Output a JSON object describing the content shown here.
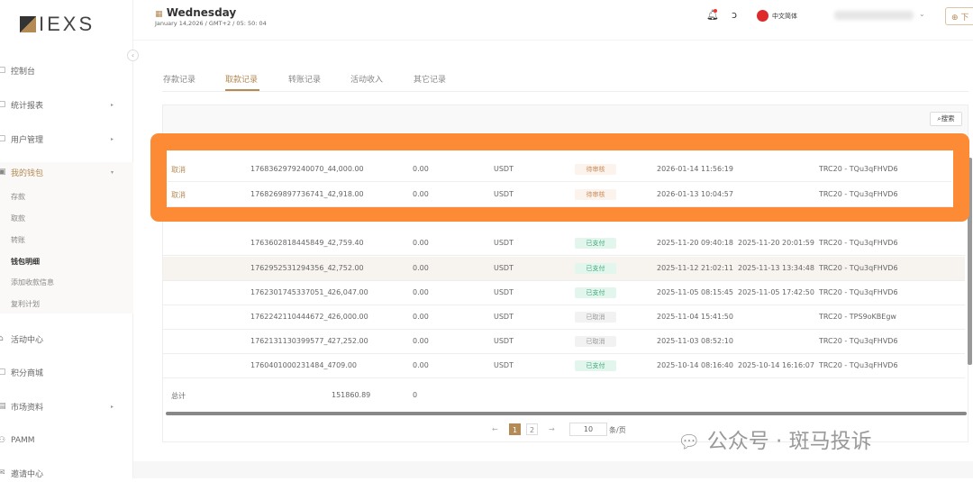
{
  "logo": "IEXS",
  "header": {
    "day": "Wednesday",
    "datetime": "January 14,2026 / GMT+2 / 05: 50: 04",
    "language": "中文简体",
    "download": "下"
  },
  "sidebar": {
    "items": [
      {
        "label": "控制台"
      },
      {
        "label": "统计报表"
      },
      {
        "label": "用户管理"
      },
      {
        "label": "我的钱包"
      },
      {
        "label": "活动中心"
      },
      {
        "label": "积分商城"
      },
      {
        "label": "市场资料"
      },
      {
        "label": "PAMM"
      },
      {
        "label": "邀请中心"
      }
    ],
    "wallet_sub": [
      "存款",
      "取款",
      "转账",
      "钱包明细",
      "添加收款信息",
      "复利计划"
    ]
  },
  "tabs": [
    "存款记录",
    "取款记录",
    "转账记录",
    "活动收入",
    "其它记录"
  ],
  "active_tab": "取款记录",
  "search_label": "搜索",
  "highlighted_rows": [
    {
      "action": "取消",
      "id": "1768362979240070_4",
      "amount": "4,000.00",
      "fee": "0.00",
      "currency": "USDT",
      "status": "待审核",
      "created": "2026-01-14 11:56:19",
      "completed": "",
      "address": "TRC20 - TQu3qFHVD6"
    },
    {
      "action": "取消",
      "id": "1768269897736741_4",
      "amount": "2,918.00",
      "fee": "0.00",
      "currency": "USDT",
      "status": "待审核",
      "created": "2026-01-13 10:04:57",
      "completed": "",
      "address": "TRC20 - TQu3qFHVD6"
    }
  ],
  "rows": [
    {
      "id": "1763602818445849_4",
      "amount": "2,759.40",
      "fee": "0.00",
      "currency": "USDT",
      "status": "已支付",
      "created": "2025-11-20 09:40:18",
      "completed": "2025-11-20 20:01:59",
      "address": "TRC20 - TQu3qFHVD6"
    },
    {
      "id": "1762952531294356_4",
      "amount": "2,752.00",
      "fee": "0.00",
      "currency": "USDT",
      "status": "已支付",
      "created": "2025-11-12 21:02:11",
      "completed": "2025-11-13 13:34:48",
      "address": "TRC20 - TQu3qFHVD6"
    },
    {
      "id": "1762301745337051_4",
      "amount": "26,047.00",
      "fee": "0.00",
      "currency": "USDT",
      "status": "已支付",
      "created": "2025-11-05 08:15:45",
      "completed": "2025-11-05 17:42:50",
      "address": "TRC20 - TQu3qFHVD6"
    },
    {
      "id": "1762242110444672_4",
      "amount": "26,000.00",
      "fee": "0.00",
      "currency": "USDT",
      "status": "已取消",
      "created": "2025-11-04 15:41:50",
      "completed": "",
      "address": "TRC20 - TPS9oKBEgw"
    },
    {
      "id": "1762131130399577_4",
      "amount": "27,252.00",
      "fee": "0.00",
      "currency": "USDT",
      "status": "已取消",
      "created": "2025-11-03 08:52:10",
      "completed": "",
      "address": "TRC20 - TQu3qFHVD6"
    },
    {
      "id": "1760401000231484_4",
      "amount": "709.00",
      "fee": "0.00",
      "currency": "USDT",
      "status": "已支付",
      "created": "2025-10-14 08:16:40",
      "completed": "2025-10-14 16:16:07",
      "address": "TRC20 - TQu3qFHVD6"
    }
  ],
  "total": {
    "label": "总计",
    "amount": "151860.89",
    "fee": "0"
  },
  "pagination": {
    "prev": "←",
    "pages": [
      "1",
      "2"
    ],
    "current": "1",
    "next": "→",
    "page_size": "10",
    "per_page_label": "条/页"
  },
  "watermark": "公众号 · 斑马投诉",
  "colors": {
    "accent": "#b48a55",
    "highlight": "#fd8a35",
    "paid_bg": "#e3f6ee",
    "paid_text": "#3aa776",
    "pending_bg": "#fbf3ec",
    "pending_text": "#c98b5a",
    "cancel_bg": "#f2f2f2"
  }
}
